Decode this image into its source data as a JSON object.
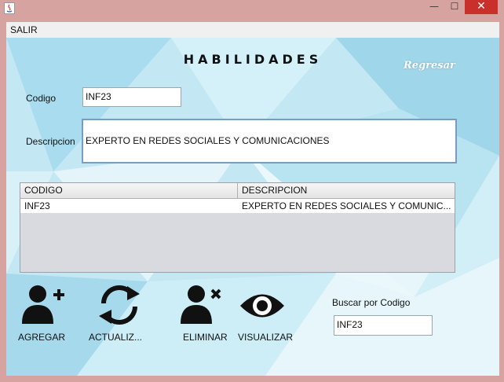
{
  "window": {
    "minimize_glyph": "—",
    "maximize_glyph": "☐",
    "close_glyph": "✕"
  },
  "menu": {
    "salir": "SALIR"
  },
  "form": {
    "heading": "HABILIDADES",
    "regresar": "Regresar",
    "codigo_label": "Codigo",
    "codigo_value": "INF23",
    "descripcion_label": "Descripcion",
    "descripcion_value": "EXPERTO EN REDES SOCIALES Y COMUNICACIONES"
  },
  "table": {
    "columns": [
      "CODIGO",
      "DESCRIPCION"
    ],
    "rows": [
      {
        "codigo": "INF23",
        "descripcion": "EXPERTO EN REDES SOCIALES Y COMUNIC..."
      }
    ]
  },
  "actions": {
    "agregar": {
      "label": "AGREGAR",
      "icon": "add-user-icon"
    },
    "actualizar": {
      "label": "ACTUALIZ...",
      "icon": "refresh-icon"
    },
    "eliminar": {
      "label": "ELIMINAR",
      "icon": "remove-user-icon"
    },
    "visualizar": {
      "label": "VISUALIZAR",
      "icon": "eye-icon"
    }
  },
  "search": {
    "label": "Buscar por Codigo",
    "value": "INF23"
  },
  "colors": {
    "title_bar": "#d7a3a0",
    "close_button": "#c9302c",
    "background": "#bfe6f2"
  }
}
